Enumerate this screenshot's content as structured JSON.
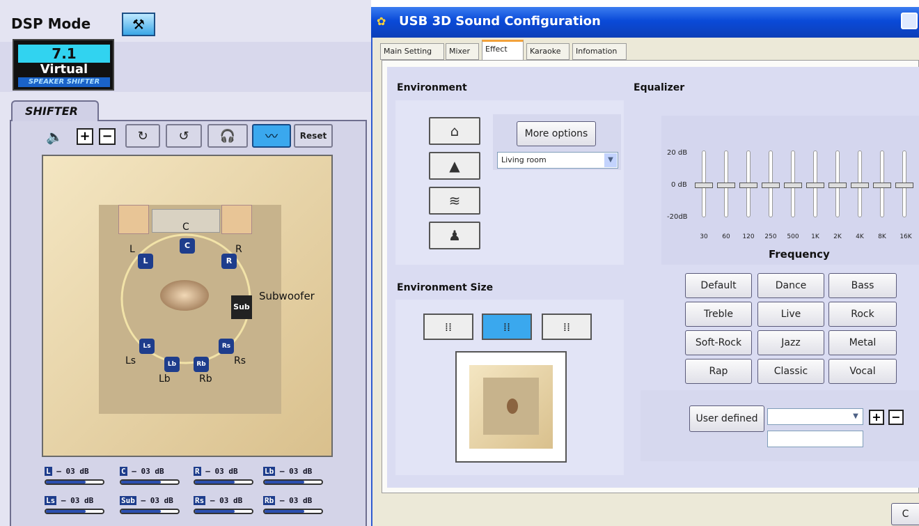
{
  "dsp": {
    "title": "DSP Mode",
    "logo": {
      "line1": "7.1",
      "line2": "Virtual",
      "line3": "SPEAKER SHIFTER"
    },
    "shifter_tab": "SHIFTER",
    "toolbar": {
      "volume_icon": "speaker-icon",
      "plus": "+",
      "minus": "−",
      "reset": "Reset"
    },
    "speakers": {
      "c": "C",
      "l": "L",
      "r": "R",
      "sub_badge": "Sub",
      "subwoofer": "Subwoofer",
      "ls": "Ls",
      "rs": "Rs",
      "lb": "Lb",
      "rb": "Rb"
    },
    "levels": [
      {
        "ch": "L",
        "value": "– 03 dB"
      },
      {
        "ch": "C",
        "value": "– 03 dB"
      },
      {
        "ch": "R",
        "value": "– 03 dB"
      },
      {
        "ch": "Lb",
        "value": "– 03 dB"
      },
      {
        "ch": "Ls",
        "value": "– 03 dB"
      },
      {
        "ch": "Sub",
        "value": "– 03 dB"
      },
      {
        "ch": "Rs",
        "value": "– 03 dB"
      },
      {
        "ch": "Rb",
        "value": "– 03 dB"
      }
    ]
  },
  "window": {
    "title": "USB 3D Sound Configuration",
    "tabs": [
      "Main Setting",
      "Mixer",
      "Effect",
      "Karaoke",
      "Infomation"
    ],
    "active_tab": "Effect",
    "environment": {
      "label": "Environment",
      "more_options": "More options",
      "preset": "Living room"
    },
    "environment_size": {
      "label": "Environment Size",
      "selected_index": 1
    },
    "equalizer": {
      "label": "Equalizer",
      "scale": {
        "top": "20 dB",
        "mid": "0 dB",
        "bottom": "-20dB"
      },
      "frequencies": [
        "30",
        "60",
        "120",
        "250",
        "500",
        "1K",
        "2K",
        "4K",
        "8K",
        "16K"
      ],
      "frequency_label": "Frequency",
      "presets": [
        "Default",
        "Dance",
        "Bass",
        "Treble",
        "Live",
        "Rock",
        "Soft-Rock",
        "Jazz",
        "Metal",
        "Rap",
        "Classic",
        "Vocal"
      ],
      "user_defined": "User defined",
      "user_defined_value": "",
      "name_value": ""
    },
    "bottom_button": "C"
  }
}
